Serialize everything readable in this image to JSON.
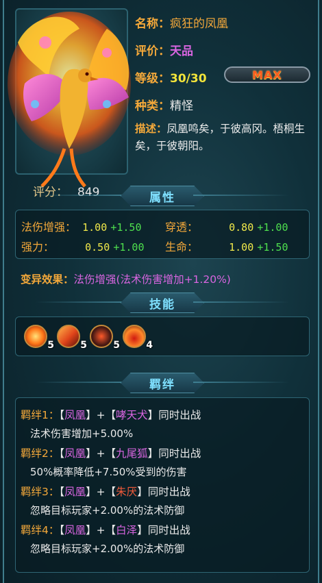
{
  "pet": {
    "name_label": "名称：",
    "name": "疯狂的凤凰",
    "rank_label": "评价：",
    "rank": "天品",
    "level_label": "等级：",
    "level": "30/30",
    "max_label": "MAX",
    "type_label": "种类：",
    "type": "精怪",
    "desc_label": "描述：",
    "desc": "凤凰鸣矣，于彼高冈。梧桐生矣，于彼朝阳。",
    "score_label": "评分：",
    "score": "849"
  },
  "attributes": {
    "title": "属性",
    "rows": [
      {
        "k1": "法伤增强：",
        "v1": "1.00",
        "p1": "+1.50",
        "k2": "穿透：",
        "v2": "0.80",
        "p2": "+1.00"
      },
      {
        "k1": "强力：",
        "v1": "0.50",
        "p1": "+1.00",
        "k2": "生命：",
        "v2": "1.00",
        "p2": "+1.50"
      }
    ]
  },
  "mutation": {
    "label": "变异效果：",
    "value": "法伤增强(法术伤害增加+1.20%)"
  },
  "skills": {
    "title": "技能",
    "items": [
      {
        "icon": "fire-orb-icon",
        "level": "5"
      },
      {
        "icon": "flame-slash-icon",
        "level": "5"
      },
      {
        "icon": "demon-claw-icon",
        "level": "5"
      },
      {
        "icon": "blood-drop-icon",
        "level": "4"
      }
    ]
  },
  "bonds": {
    "title": "羁绊",
    "items": [
      {
        "label": "羁绊1：",
        "a": "凤凰",
        "b": "哮天犬",
        "suffix": "同时出战",
        "effect": "法术伤害增加+5.00%"
      },
      {
        "label": "羁绊2：",
        "a": "凤凰",
        "b": "九尾狐",
        "suffix": "同时出战",
        "effect": "50%概率降低+7.50%受到的伤害"
      },
      {
        "label": "羁绊3：",
        "a": "凤凰",
        "b": "朱厌",
        "suffix": "同时出战",
        "effect": "忽略目标玩家+2.00%的法术防御"
      },
      {
        "label": "羁绊4：",
        "a": "凤凰",
        "b": "白泽",
        "suffix": "同时出战",
        "effect": "忽略目标玩家+2.00%的法术防御"
      }
    ]
  },
  "colors": {
    "label_orange": "#f3a83a",
    "purple": "#d865e0",
    "yellow": "#f0e84a",
    "green": "#4ee04e",
    "header_cyan": "#7fe0ff"
  }
}
